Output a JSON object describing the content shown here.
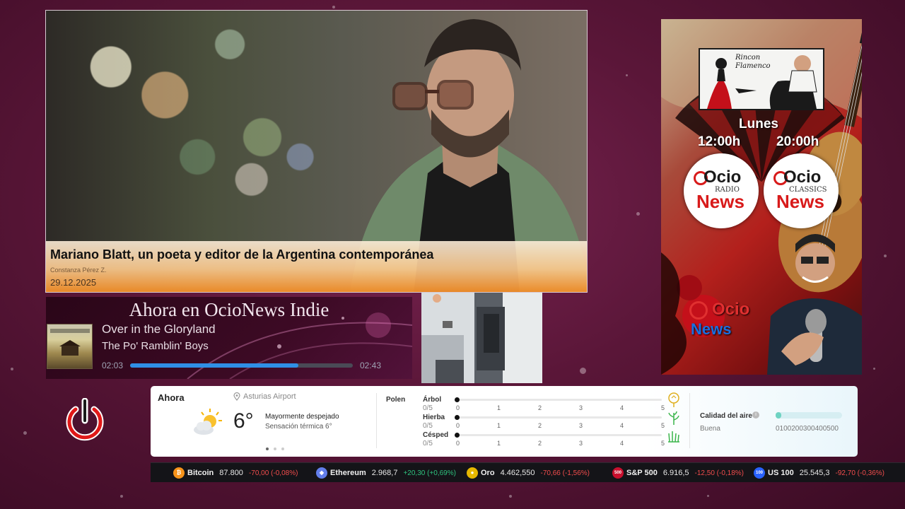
{
  "news": {
    "title": "Mariano Blatt, un poeta y editor de la Argentina contemporánea",
    "author": "Constanza Pérez Z.",
    "date": "29.12.2025"
  },
  "now_playing": {
    "header": "Ahora en OcioNews Indie",
    "song_title": "Over in the Gloryland",
    "artist": "The Po' Ramblin' Boys",
    "elapsed": "02:03",
    "total": "02:43",
    "progress_percent": 75.5,
    "progress_color": "#2f8fe6"
  },
  "poster": {
    "rincon_line1": "Rincon",
    "rincon_line2": "Flamenco",
    "day": "Lunes",
    "time_left": "12:00h",
    "time_right": "20:00h",
    "badge_left": {
      "top": "Ocio",
      "sub": "RADIO",
      "bottom": "News"
    },
    "badge_right": {
      "top": "Ocio",
      "sub": "CLASSICS",
      "bottom": "News"
    },
    "logo_top": "Ocio",
    "logo_bottom": "News"
  },
  "weather": {
    "now_label": "Ahora",
    "location": "Asturias Airport",
    "temperature": "6°",
    "condition": "Mayormente despejado",
    "feels_like": "Sensación térmica 6°",
    "icon": "partly-sunny-icon",
    "pollen": {
      "label": "Polen",
      "scale": [
        "0",
        "1",
        "2",
        "3",
        "4",
        "5"
      ],
      "items": [
        {
          "name": "Árbol",
          "value": "0/5",
          "icon": "tree-pollen-icon"
        },
        {
          "name": "Hierba",
          "value": "0/5",
          "icon": "weed-pollen-icon"
        },
        {
          "name": "Césped",
          "value": "0/5",
          "icon": "grass-pollen-icon"
        }
      ]
    },
    "air_quality": {
      "label": "Calidad del aire",
      "status": "Buena",
      "scale_text": "0100200300400500",
      "level_percent": 8,
      "color": "#6fd3c2"
    }
  },
  "ticker": [
    {
      "name": "Bitcoin",
      "price": "87.800",
      "change": "-70,00 (-0,08%)",
      "icon": "bitcoin-icon",
      "icon_text": "₿",
      "color": "#f7931a",
      "up": false
    },
    {
      "name": "Ethereum",
      "price": "2.968,7",
      "change": "+20,30 (+0,69%)",
      "icon": "ethereum-icon",
      "icon_text": "◆",
      "color": "#627eea",
      "up": true
    },
    {
      "name": "Oro",
      "price": "4.462,550",
      "change": "-70,66 (-1,56%)",
      "icon": "gold-icon",
      "icon_text": "●",
      "color": "#e6b800",
      "up": false
    },
    {
      "name": "S&P 500",
      "price": "6.916,5",
      "change": "-12,50 (-0,18%)",
      "icon": "sp500-icon",
      "icon_text": "500",
      "color": "#c8102e",
      "up": false
    },
    {
      "name": "US 100",
      "price": "25.545,3",
      "change": "-92,70 (-0,36%)",
      "icon": "us100-icon",
      "icon_text": "100",
      "color": "#2962ff",
      "up": false
    }
  ]
}
